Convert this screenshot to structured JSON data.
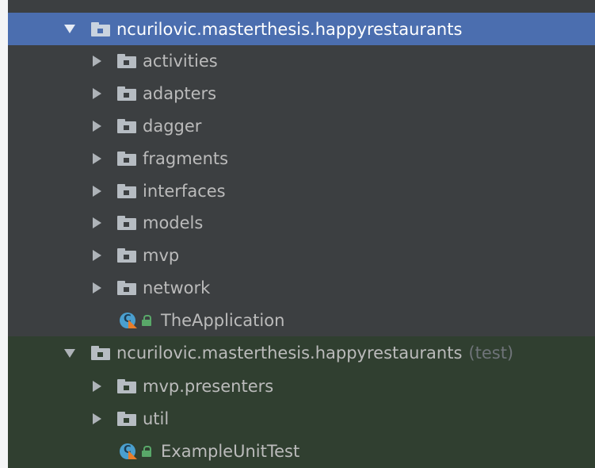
{
  "tree": {
    "package_main": {
      "label": "ncurilovic.masterthesis.happyrestaurants",
      "children": [
        {
          "label": "activities"
        },
        {
          "label": "adapters"
        },
        {
          "label": "dagger"
        },
        {
          "label": "fragments"
        },
        {
          "label": "interfaces"
        },
        {
          "label": "models"
        },
        {
          "label": "mvp"
        },
        {
          "label": "network"
        }
      ],
      "class_item": "TheApplication"
    },
    "package_test": {
      "label": "ncurilovic.masterthesis.happyrestaurants",
      "suffix": "(test)",
      "children": [
        {
          "label": "mvp.presenters"
        },
        {
          "label": "util"
        }
      ],
      "class_item": "ExampleUnitTest"
    }
  },
  "icons": {
    "expand_collapsed": "chevron-right-icon",
    "expand_open": "chevron-down-icon",
    "package": "package-folder-icon",
    "class": "class-runnable-icon",
    "access": "lock-icon"
  },
  "colors": {
    "background": "#3c3f41",
    "selection": "#4b6eaf",
    "test_section": "#303f30",
    "text": "#bbbbbb",
    "suffix_text": "#6f7479"
  }
}
